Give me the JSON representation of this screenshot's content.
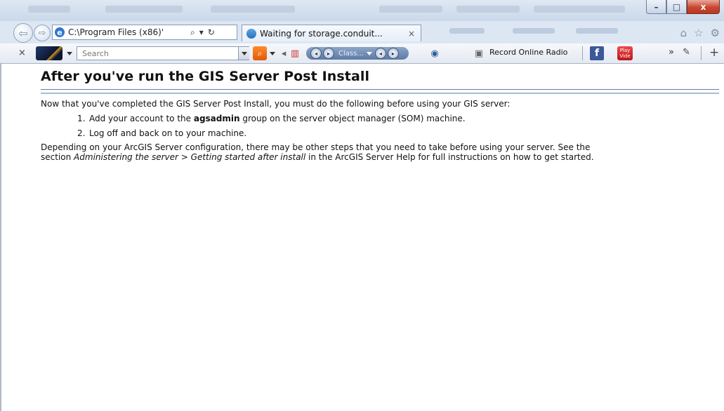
{
  "window": {
    "minimize_glyph": "–",
    "maximize_glyph": "□",
    "close_glyph": "x"
  },
  "navbar": {
    "address": "C:\\Program Files (x86)'",
    "tab_title": "Waiting for storage.conduit...",
    "tab_close": "×",
    "search_glyph": "⌕",
    "dropdown_glyph": "▾",
    "refresh_glyph": "↻"
  },
  "toolbar": {
    "close_glyph": "×",
    "search_placeholder": "Search",
    "radio_label": "Class...",
    "record_label": "Record Online Radio",
    "facebook_glyph": "f",
    "youtube_label": "Play Vide",
    "chevron_glyph": "»"
  },
  "page": {
    "heading": "After you've run the GIS Server Post Install",
    "intro": "Now that you've completed the GIS Server Post Install, you must do the following before using your GIS server:",
    "steps": [
      {
        "num": "1.",
        "pre": "Add your account to the ",
        "bold": "agsadmin",
        "post": " group on the server object manager (SOM) machine."
      },
      {
        "num": "2.",
        "text": "Log off and back on to your machine."
      }
    ],
    "note_line1": "Depending on your ArcGIS Server configuration, there may be other steps that you need to take before using your server. See the",
    "note_line2_pre": "section ",
    "note_line2_italic": "Administering the server > Getting started after install",
    "note_line2_post": " in the ArcGIS Server Help for full instructions on how to get started."
  }
}
